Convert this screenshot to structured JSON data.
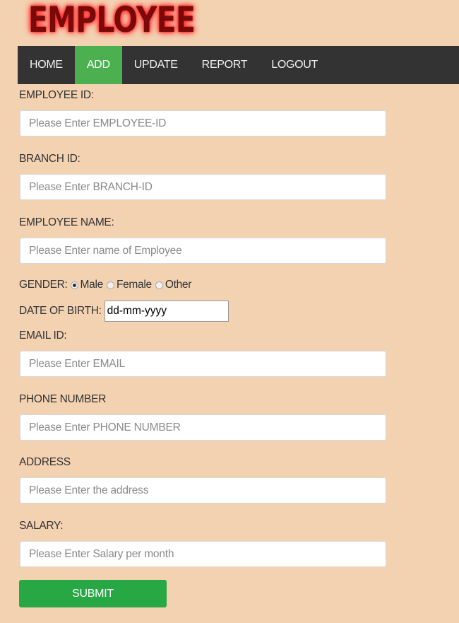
{
  "header": {
    "logo_text": "EMPLOYEE"
  },
  "nav": {
    "items": [
      {
        "label": "HOME"
      },
      {
        "label": "ADD",
        "active": true
      },
      {
        "label": "UPDATE"
      },
      {
        "label": "REPORT"
      },
      {
        "label": "LOGOUT"
      }
    ]
  },
  "form": {
    "employee_id": {
      "label": "EMPLOYEE ID:",
      "placeholder": "Please Enter EMPLOYEE-ID"
    },
    "branch_id": {
      "label": "BRANCH ID:",
      "placeholder": "Please Enter BRANCH-ID"
    },
    "employee_name": {
      "label": "EMPLOYEE NAME:",
      "placeholder": "Please Enter name of Employee"
    },
    "gender": {
      "label": "GENDER:",
      "options": [
        "Male",
        "Female",
        "Other"
      ],
      "selected": "Male"
    },
    "dob": {
      "label": "DATE OF BIRTH:",
      "value": "dd-mm-yyyy"
    },
    "email": {
      "label": "EMAIL ID:",
      "placeholder": "Please Enter EMAIL"
    },
    "phone": {
      "label": "PHONE NUMBER",
      "placeholder": "Please Enter PHONE NUMBER"
    },
    "address": {
      "label": "ADDRESS",
      "placeholder": "Please Enter the address"
    },
    "salary": {
      "label": "SALARY:",
      "placeholder": "Please Enter Salary per month"
    },
    "submit_label": "SUBMIT"
  },
  "colors": {
    "background": "#f3d2b2",
    "navbar": "#333333",
    "nav_active": "#4caf50",
    "submit": "#28a745",
    "logo": "#7a0a0a"
  }
}
